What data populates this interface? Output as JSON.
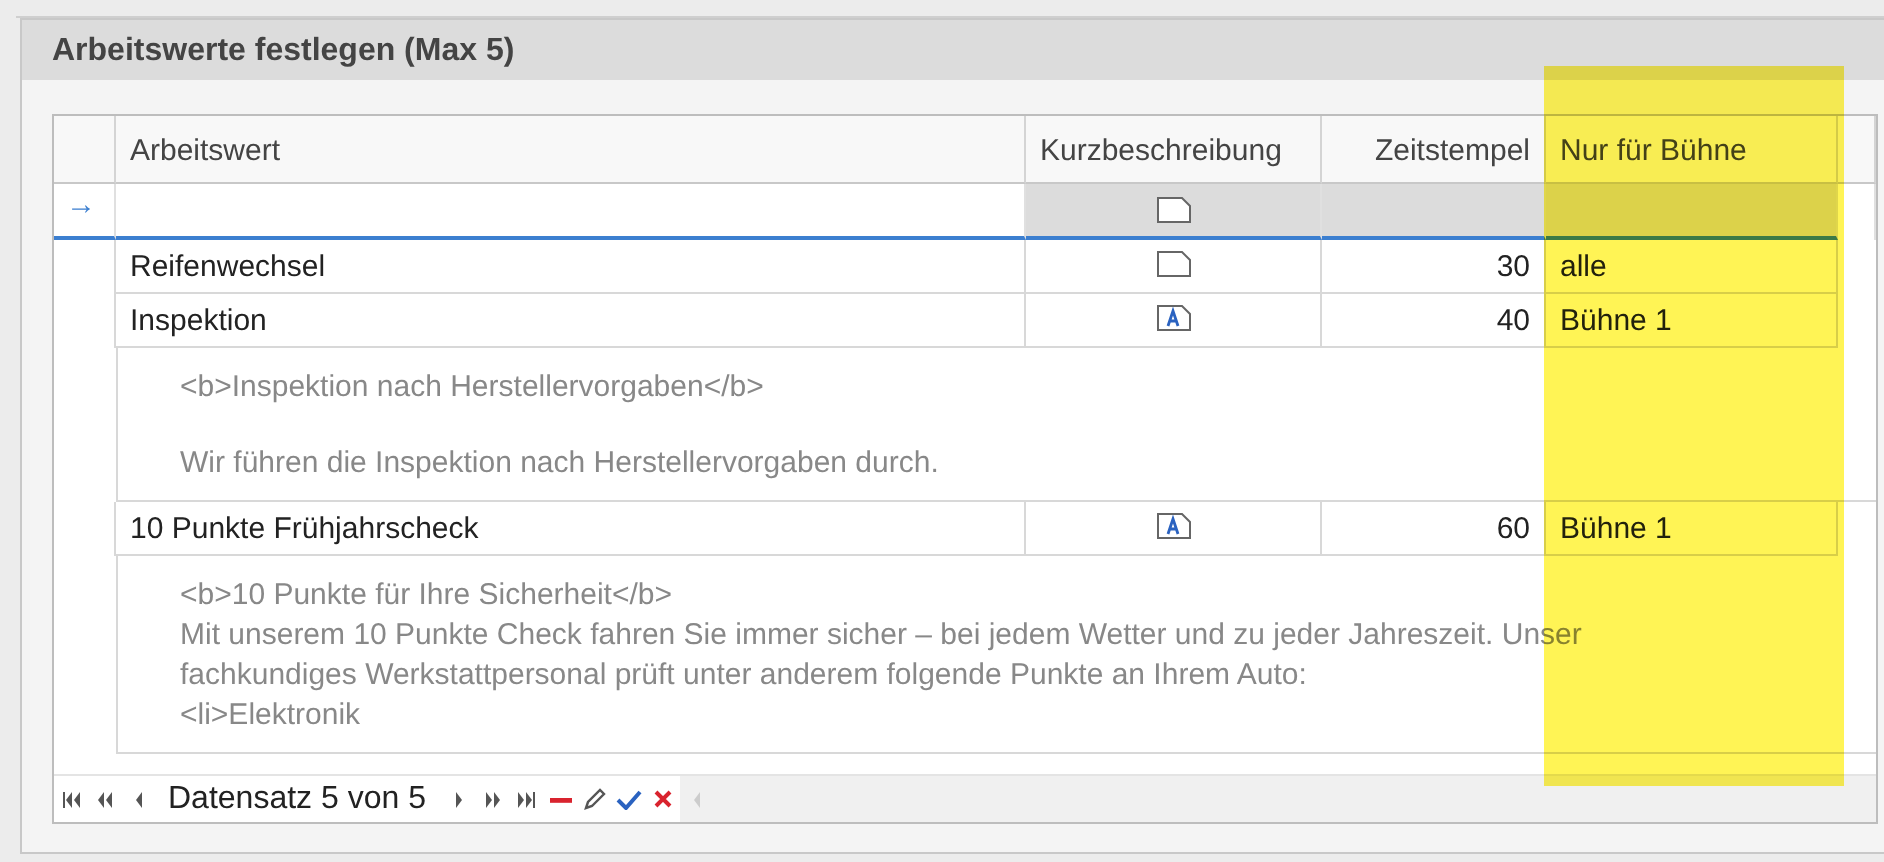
{
  "panel": {
    "title": "Arbeitswerte festlegen (Max 5)"
  },
  "grid": {
    "columns": [
      {
        "label": "Arbeitswert",
        "highlighted": false
      },
      {
        "label": "Kurzbeschreibung",
        "highlighted": false
      },
      {
        "label": "Zeitstempel",
        "highlighted": false
      },
      {
        "label": "Nur für Bühne",
        "highlighted": true
      }
    ],
    "new_row": {
      "indicator": "→"
    },
    "rows": [
      {
        "arbeitswert": "Reifenwechsel",
        "has_description": false,
        "zeitstempel": "30",
        "buehne": "alle"
      },
      {
        "arbeitswert": "Inspektion",
        "has_description": true,
        "zeitstempel": "40",
        "buehne": "Bühne 1",
        "details": [
          {
            "text": "<b>Inspektion nach Herstellervorgaben</b>",
            "gap_before": false
          },
          {
            "text": "Wir führen die Inspektion nach Herstellervorgaben durch.",
            "gap_before": true
          }
        ]
      },
      {
        "arbeitswert": "10 Punkte Frühjahrscheck",
        "has_description": true,
        "zeitstempel": "60",
        "buehne": "Bühne 1",
        "details": [
          {
            "text": "<b>10 Punkte für Ihre Sicherheit</b>",
            "gap_before": false
          },
          {
            "text": "Mit unserem 10 Punkte Check fahren Sie immer sicher – bei jedem Wetter und zu jeder Jahreszeit. Unser",
            "gap_before": false
          },
          {
            "text": "fachkundiges Werkstattpersonal prüft unter anderem folgende Punkte an Ihrem Auto:",
            "gap_before": false
          },
          {
            "text": "<li>Elektronik",
            "gap_before": false
          }
        ]
      }
    ]
  },
  "navigator": {
    "text": "Datensatz 5 von 5"
  }
}
